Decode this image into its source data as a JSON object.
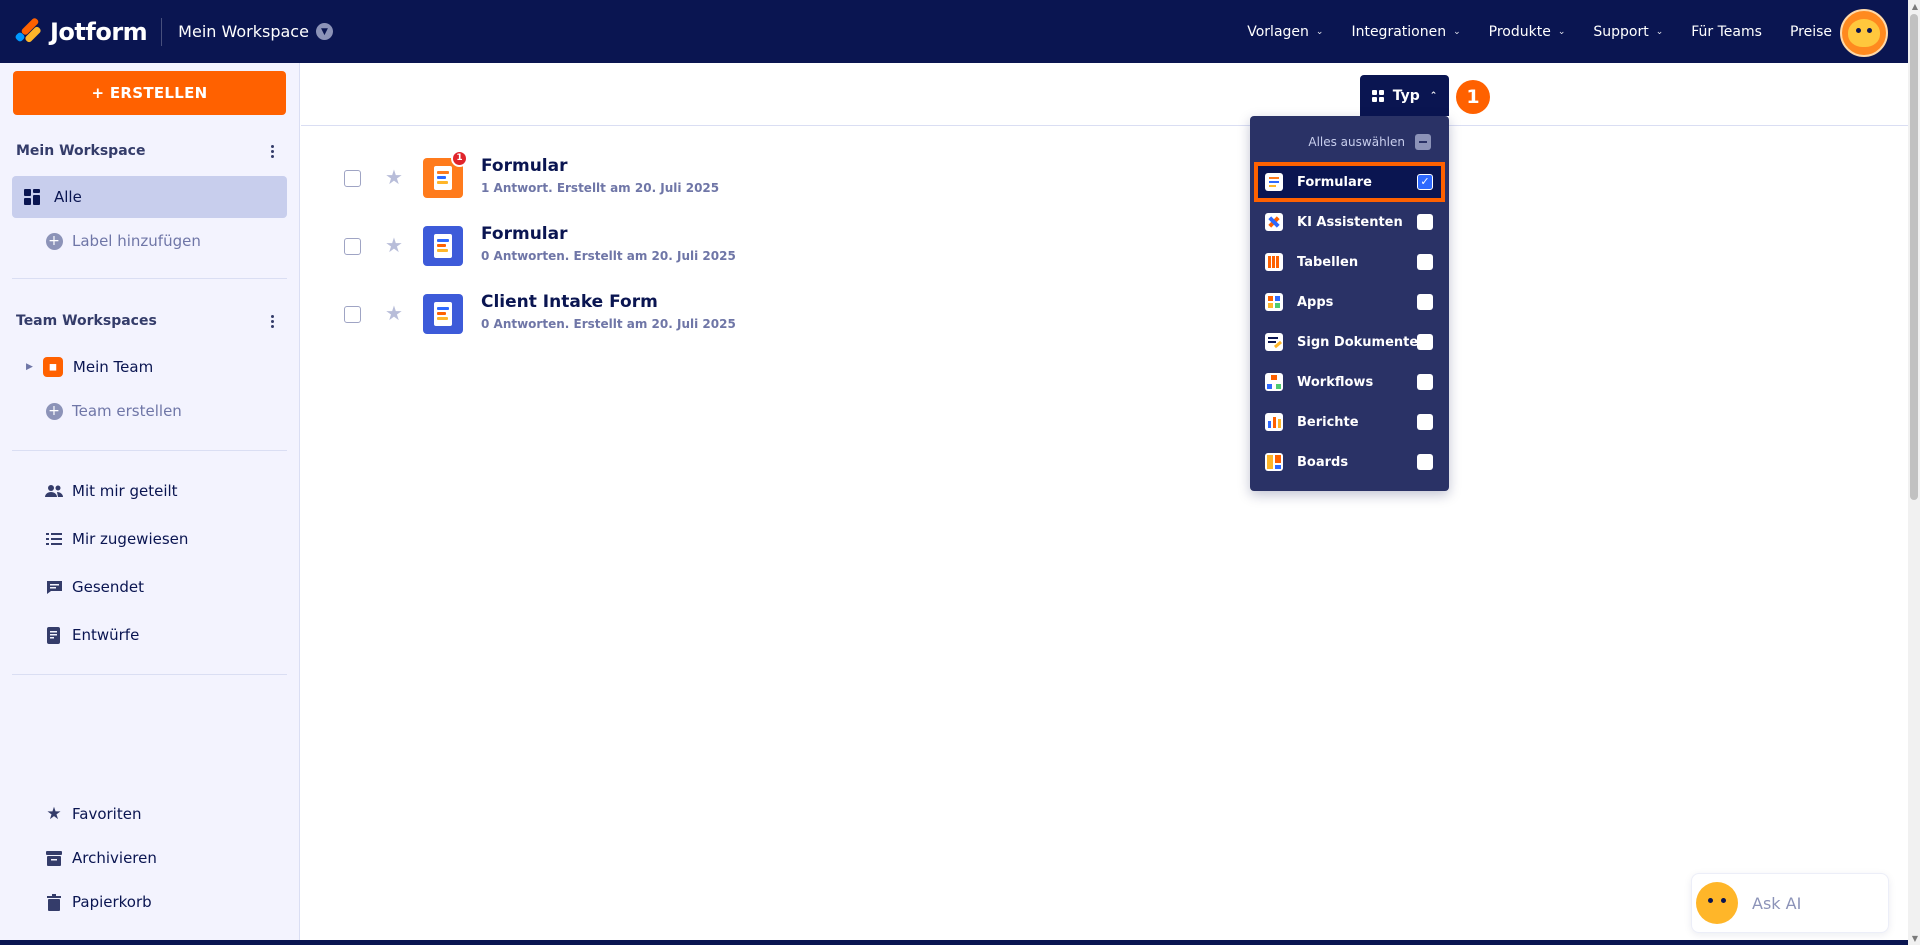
{
  "header": {
    "brand": "Jotform",
    "workspace": "Mein Workspace",
    "nav": [
      {
        "label": "Vorlagen",
        "caret": true
      },
      {
        "label": "Integrationen",
        "caret": true
      },
      {
        "label": "Produkte",
        "caret": true
      },
      {
        "label": "Support",
        "caret": true
      },
      {
        "label": "Für Teams",
        "caret": false
      },
      {
        "label": "Preise",
        "caret": false
      }
    ]
  },
  "sidebar": {
    "create_label": "+ ERSTELLEN",
    "my_workspace_title": "Mein Workspace",
    "all_label": "Alle",
    "add_label": "Label hinzufügen",
    "team_workspaces_title": "Team Workspaces",
    "team_name": "Mein Team",
    "create_team": "Team erstellen",
    "shared": "Mit mir geteilt",
    "assigned": "Mir zugewiesen",
    "sent": "Gesendet",
    "drafts": "Entwürfe",
    "favorites": "Favoriten",
    "archive": "Archivieren",
    "trash": "Papierkorb"
  },
  "filter": {
    "type_label": "Typ",
    "step_number": "1",
    "select_all": "Alles auswählen",
    "options": [
      {
        "label": "Formulare",
        "checked": true
      },
      {
        "label": "KI Assistenten",
        "checked": false
      },
      {
        "label": "Tabellen",
        "checked": false
      },
      {
        "label": "Apps",
        "checked": false
      },
      {
        "label": "Sign Dokumente",
        "checked": false
      },
      {
        "label": "Workflows",
        "checked": false
      },
      {
        "label": "Berichte",
        "checked": false
      },
      {
        "label": "Boards",
        "checked": false
      }
    ]
  },
  "forms": [
    {
      "title": "Formular",
      "meta": "1 Antwort. Erstellt am 20. Juli 2025",
      "badge": "1",
      "icon_color": "#ff7b1c"
    },
    {
      "title": "Formular",
      "meta": "0 Antworten. Erstellt am 20. Juli 2025",
      "badge": null,
      "icon_color": "#3d5bd9"
    },
    {
      "title": "Client Intake Form",
      "meta": "0 Antworten. Erstellt am 20. Juli 2025",
      "badge": null,
      "icon_color": "#3d5bd9"
    }
  ],
  "ask_ai": "Ask AI",
  "colors": {
    "navy": "#0a1551",
    "orange": "#ff6100",
    "dropdown_bg": "#2a3266",
    "check_blue": "#2e69ff"
  }
}
